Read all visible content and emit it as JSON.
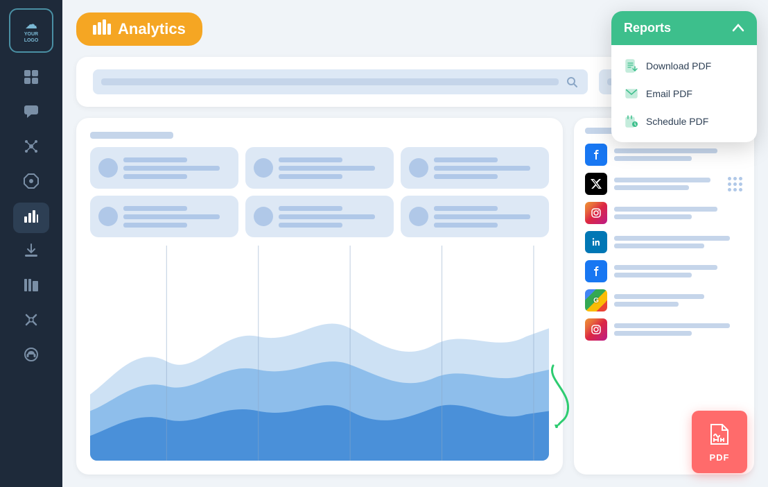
{
  "sidebar": {
    "logo": {
      "icon": "☁",
      "text": "YOUR\nLOGO"
    },
    "items": [
      {
        "name": "dashboard",
        "icon": "⊞",
        "active": false
      },
      {
        "name": "messages",
        "icon": "💬",
        "active": false
      },
      {
        "name": "network",
        "icon": "✳",
        "active": false
      },
      {
        "name": "settings-gear",
        "icon": "◈",
        "active": false
      },
      {
        "name": "analytics",
        "icon": "📊",
        "active": true
      },
      {
        "name": "download",
        "icon": "⬇",
        "active": false
      },
      {
        "name": "library",
        "icon": "📚",
        "active": false
      },
      {
        "name": "tools",
        "icon": "✂",
        "active": false
      },
      {
        "name": "support",
        "icon": "🎧",
        "active": false
      }
    ]
  },
  "header": {
    "badge_label": "Analytics",
    "badge_icon": "📊"
  },
  "search": {
    "placeholder": "",
    "dropdown_placeholder": ""
  },
  "reports_popup": {
    "title": "Reports",
    "items": [
      {
        "label": "Download PDF",
        "icon": "📄"
      },
      {
        "label": "Email PDF",
        "icon": "📄"
      },
      {
        "label": "Schedule PDF",
        "icon": "📄"
      }
    ]
  },
  "pdf": {
    "label": "PDF"
  },
  "social_rows": [
    {
      "platform": "facebook",
      "color": "#1877f2",
      "letter": "f"
    },
    {
      "platform": "twitter",
      "color": "#000",
      "letter": "𝕏"
    },
    {
      "platform": "instagram",
      "color": "instagram",
      "letter": "📷"
    },
    {
      "platform": "linkedin",
      "color": "#0077b5",
      "letter": "in"
    },
    {
      "platform": "facebook2",
      "color": "#1877f2",
      "letter": "f"
    },
    {
      "platform": "googlebusiness",
      "color": "#4285f4",
      "letter": "G"
    },
    {
      "platform": "instagram2",
      "color": "instagram",
      "letter": "📷"
    }
  ]
}
